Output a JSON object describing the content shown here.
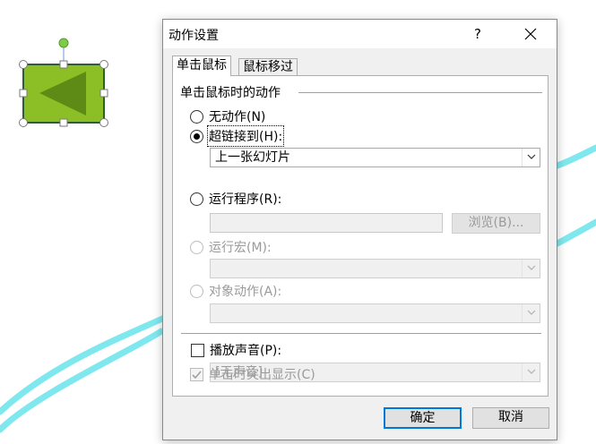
{
  "dialog": {
    "title": "动作设置",
    "help_label": "?",
    "tabs": [
      {
        "label": "单击鼠标",
        "active": true
      },
      {
        "label": "鼠标移过",
        "active": false
      }
    ],
    "group_title": "单击鼠标时的动作",
    "options": {
      "none": {
        "label": "无动作(N)",
        "selected": false,
        "enabled": true
      },
      "hyperlink": {
        "label": "超链接到(H):",
        "selected": true,
        "enabled": true,
        "value": "上一张幻灯片"
      },
      "run_program": {
        "label": "运行程序(R):",
        "selected": false,
        "enabled": true,
        "browse_label": "浏览(B)..."
      },
      "run_macro": {
        "label": "运行宏(M):",
        "selected": false,
        "enabled": false
      },
      "object_action": {
        "label": "对象动作(A):",
        "selected": false,
        "enabled": false
      }
    },
    "play_sound": {
      "label": "播放声音(P):",
      "checked": false,
      "value": "[无声音]"
    },
    "highlight_click": {
      "label": "单击时突出显示(C)",
      "checked": true,
      "enabled": false
    },
    "ok_label": "确定",
    "cancel_label": "取消"
  },
  "colors": {
    "shape_fill": "#8cbf26",
    "shape_arrow": "#5e8a16",
    "shape_border": "#2f5f2f",
    "handle_rotate": "#7ecb4a",
    "background_swoosh": "#7fe8ee",
    "accent": "#0078d7"
  }
}
